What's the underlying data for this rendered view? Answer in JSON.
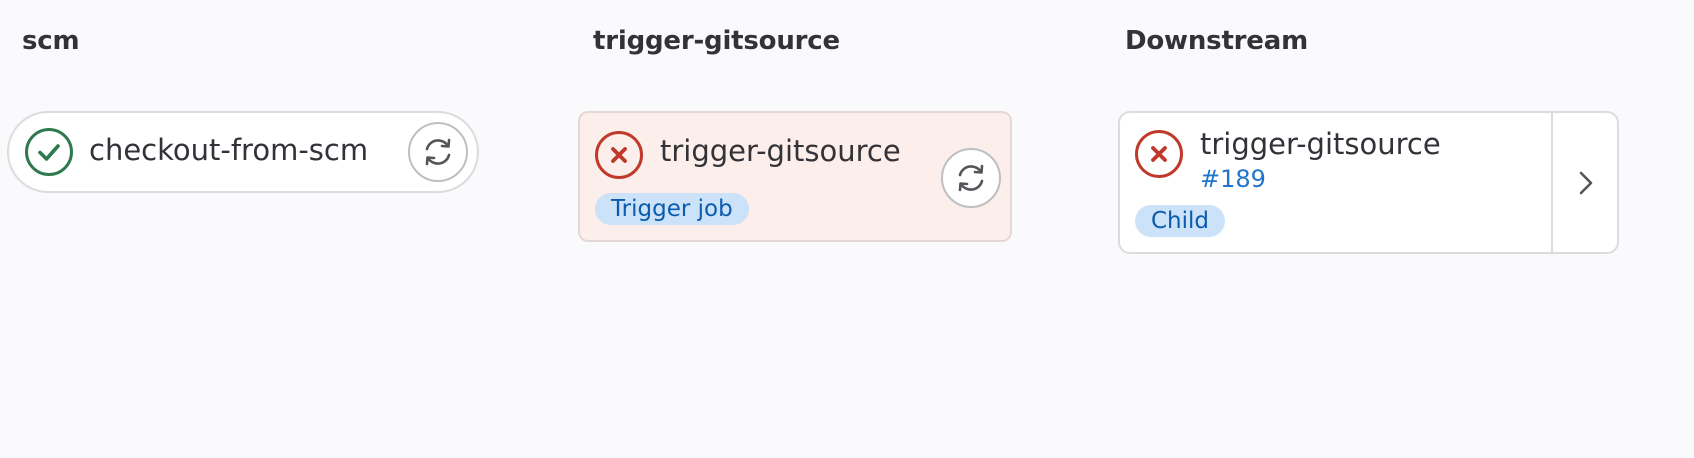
{
  "stages": [
    {
      "title": "scm"
    },
    {
      "title": "trigger-gitsource"
    },
    {
      "title": "Downstream"
    }
  ],
  "scm_job": {
    "name": "checkout-from-scm",
    "status": "success",
    "status_color": "#2f7a4d",
    "action_icon": "retry-icon"
  },
  "trigger_job": {
    "name": "trigger-gitsource",
    "status": "failed",
    "status_color": "#c0392b",
    "badge": "Trigger job",
    "action_icon": "retry-icon"
  },
  "downstream_pipeline": {
    "name": "trigger-gitsource",
    "pipeline_id": "#189",
    "status": "failed",
    "status_color": "#c0392b",
    "badge": "Child",
    "expand_icon": "chevron-right-icon"
  },
  "colors": {
    "background": "#fafafc",
    "failed_card_bg": "#fbeeeb",
    "badge_bg": "#cbe2f9",
    "badge_text": "#0b5cad",
    "link": "#1f75cb"
  }
}
